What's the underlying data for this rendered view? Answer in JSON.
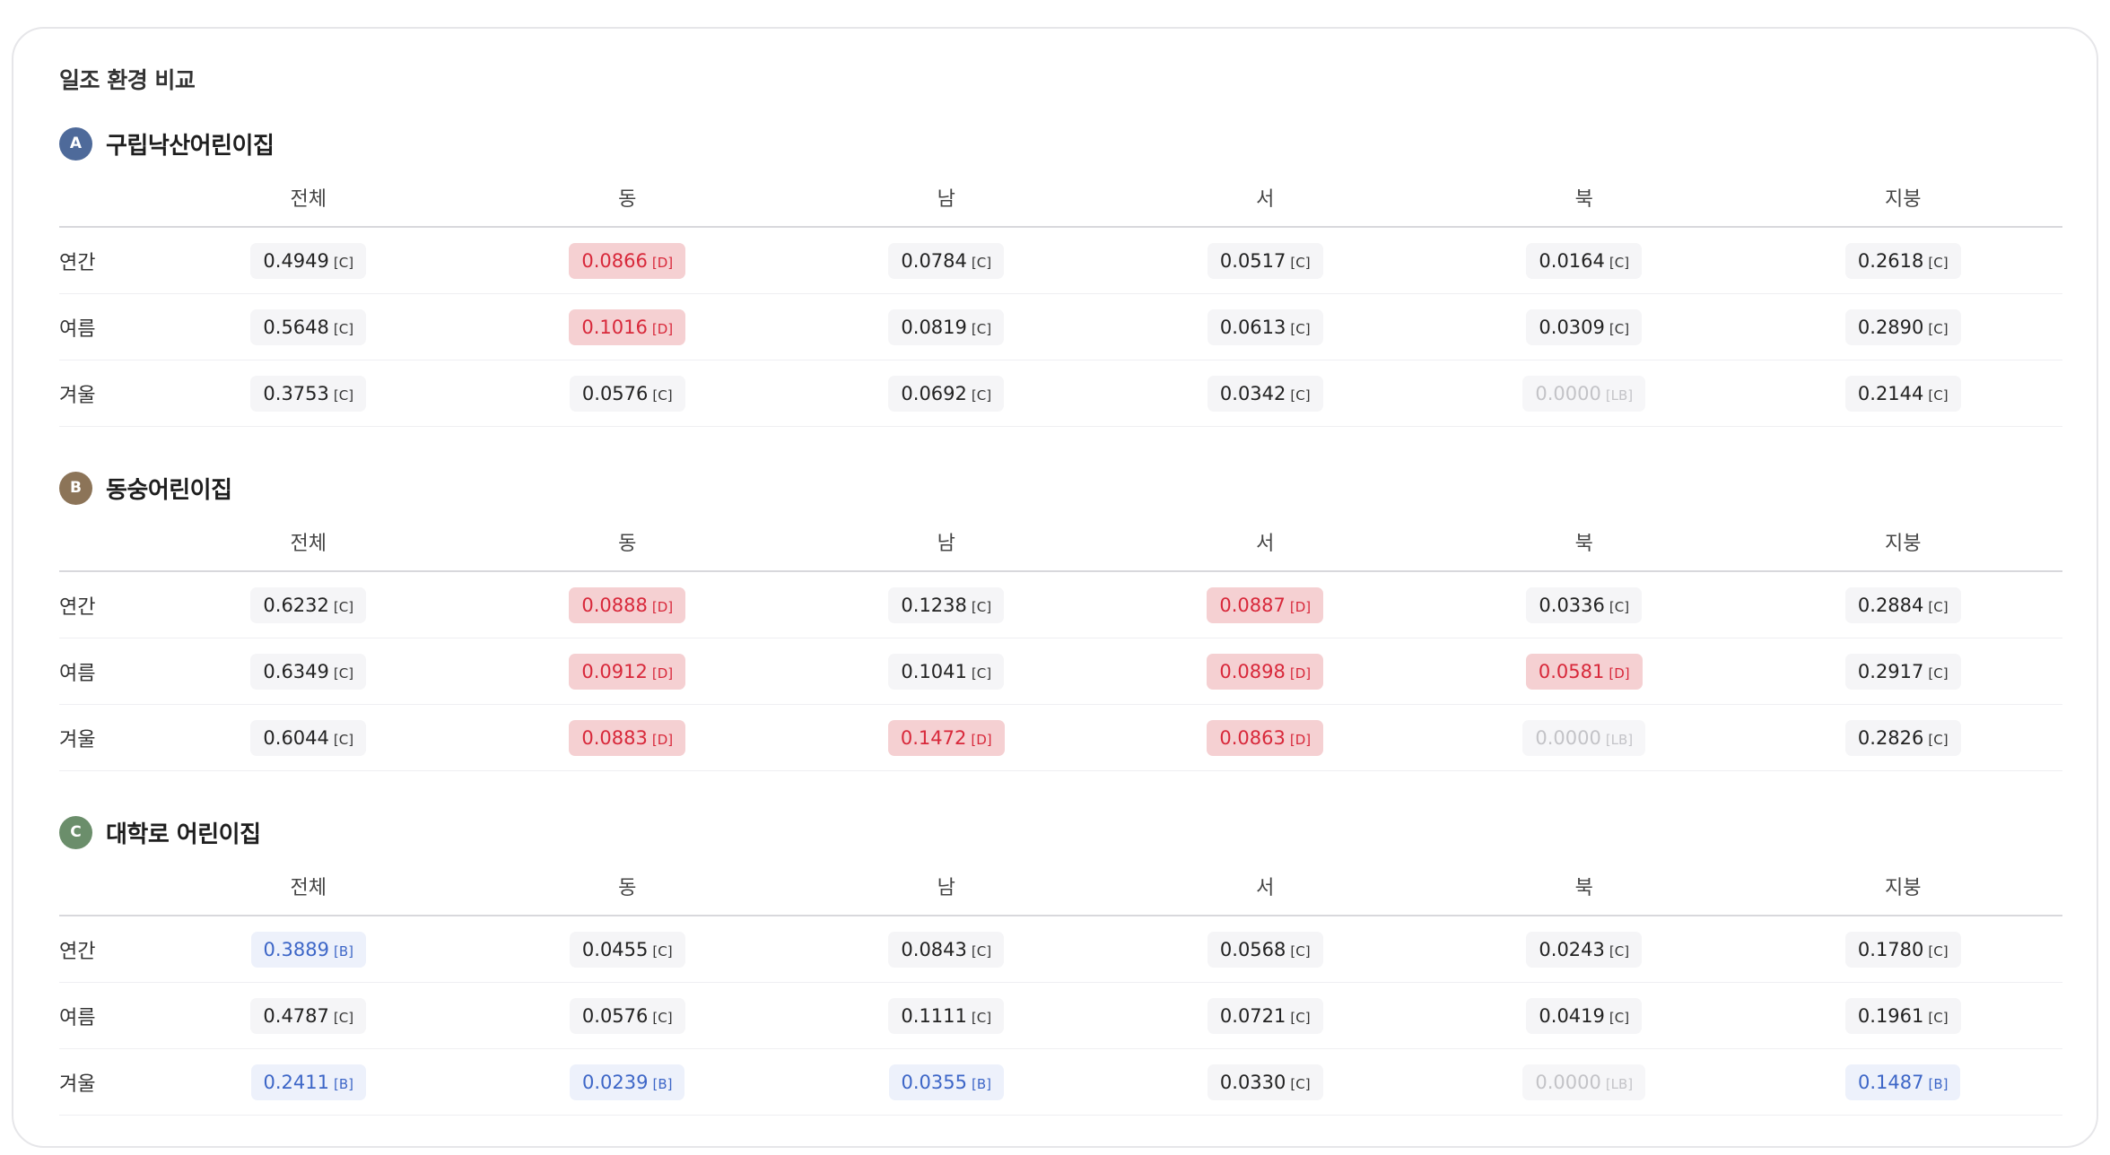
{
  "title": "일조 환경 비교",
  "colors": {
    "badge_a": "#4e6a9a",
    "badge_b": "#8c7458",
    "badge_c": "#6b8e6b",
    "grade_d_bg": "#f5d0d2",
    "grade_d_text": "#d8283a",
    "grade_b_bg": "#edf1fb",
    "grade_b_text": "#3d66c7",
    "grade_lb_text": "#c3c3c7"
  },
  "sections": [
    {
      "badge": "A",
      "name": "구립낙산어린이집",
      "columns": [
        "전체",
        "동",
        "남",
        "서",
        "북",
        "지붕"
      ],
      "rows": [
        {
          "label": "연간",
          "cells": [
            {
              "value": "0.4949",
              "grade": "C"
            },
            {
              "value": "0.0866",
              "grade": "D"
            },
            {
              "value": "0.0784",
              "grade": "C"
            },
            {
              "value": "0.0517",
              "grade": "C"
            },
            {
              "value": "0.0164",
              "grade": "C"
            },
            {
              "value": "0.2618",
              "grade": "C"
            }
          ]
        },
        {
          "label": "여름",
          "cells": [
            {
              "value": "0.5648",
              "grade": "C"
            },
            {
              "value": "0.1016",
              "grade": "D"
            },
            {
              "value": "0.0819",
              "grade": "C"
            },
            {
              "value": "0.0613",
              "grade": "C"
            },
            {
              "value": "0.0309",
              "grade": "C"
            },
            {
              "value": "0.2890",
              "grade": "C"
            }
          ]
        },
        {
          "label": "겨울",
          "cells": [
            {
              "value": "0.3753",
              "grade": "C"
            },
            {
              "value": "0.0576",
              "grade": "C"
            },
            {
              "value": "0.0692",
              "grade": "C"
            },
            {
              "value": "0.0342",
              "grade": "C"
            },
            {
              "value": "0.0000",
              "grade": "LB"
            },
            {
              "value": "0.2144",
              "grade": "C"
            }
          ]
        }
      ]
    },
    {
      "badge": "B",
      "name": "동숭어린이집",
      "columns": [
        "전체",
        "동",
        "남",
        "서",
        "북",
        "지붕"
      ],
      "rows": [
        {
          "label": "연간",
          "cells": [
            {
              "value": "0.6232",
              "grade": "C"
            },
            {
              "value": "0.0888",
              "grade": "D"
            },
            {
              "value": "0.1238",
              "grade": "C"
            },
            {
              "value": "0.0887",
              "grade": "D"
            },
            {
              "value": "0.0336",
              "grade": "C"
            },
            {
              "value": "0.2884",
              "grade": "C"
            }
          ]
        },
        {
          "label": "여름",
          "cells": [
            {
              "value": "0.6349",
              "grade": "C"
            },
            {
              "value": "0.0912",
              "grade": "D"
            },
            {
              "value": "0.1041",
              "grade": "C"
            },
            {
              "value": "0.0898",
              "grade": "D"
            },
            {
              "value": "0.0581",
              "grade": "D"
            },
            {
              "value": "0.2917",
              "grade": "C"
            }
          ]
        },
        {
          "label": "겨울",
          "cells": [
            {
              "value": "0.6044",
              "grade": "C"
            },
            {
              "value": "0.0883",
              "grade": "D"
            },
            {
              "value": "0.1472",
              "grade": "D"
            },
            {
              "value": "0.0863",
              "grade": "D"
            },
            {
              "value": "0.0000",
              "grade": "LB"
            },
            {
              "value": "0.2826",
              "grade": "C"
            }
          ]
        }
      ]
    },
    {
      "badge": "C",
      "name": "대학로 어린이집",
      "columns": [
        "전체",
        "동",
        "남",
        "서",
        "북",
        "지붕"
      ],
      "rows": [
        {
          "label": "연간",
          "cells": [
            {
              "value": "0.3889",
              "grade": "B"
            },
            {
              "value": "0.0455",
              "grade": "C"
            },
            {
              "value": "0.0843",
              "grade": "C"
            },
            {
              "value": "0.0568",
              "grade": "C"
            },
            {
              "value": "0.0243",
              "grade": "C"
            },
            {
              "value": "0.1780",
              "grade": "C"
            }
          ]
        },
        {
          "label": "여름",
          "cells": [
            {
              "value": "0.4787",
              "grade": "C"
            },
            {
              "value": "0.0576",
              "grade": "C"
            },
            {
              "value": "0.1111",
              "grade": "C"
            },
            {
              "value": "0.0721",
              "grade": "C"
            },
            {
              "value": "0.0419",
              "grade": "C"
            },
            {
              "value": "0.1961",
              "grade": "C"
            }
          ]
        },
        {
          "label": "겨울",
          "cells": [
            {
              "value": "0.2411",
              "grade": "B"
            },
            {
              "value": "0.0239",
              "grade": "B"
            },
            {
              "value": "0.0355",
              "grade": "B"
            },
            {
              "value": "0.0330",
              "grade": "C"
            },
            {
              "value": "0.0000",
              "grade": "LB"
            },
            {
              "value": "0.1487",
              "grade": "B"
            }
          ]
        }
      ]
    }
  ]
}
